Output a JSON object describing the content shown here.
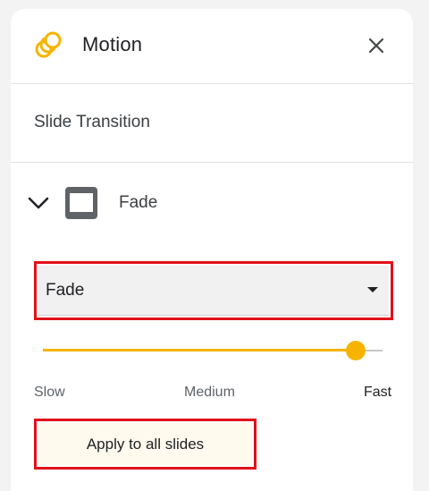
{
  "header": {
    "title": "Motion",
    "icon": "motion-icon",
    "close_icon": "close-icon"
  },
  "section": {
    "title": "Slide Transition"
  },
  "transition": {
    "expand_icon": "chevron-down-icon",
    "thumbnail_icon": "slide-thumbnail-icon",
    "name": "Fade"
  },
  "type_select": {
    "value": "Fade"
  },
  "speed": {
    "labels": {
      "slow": "Slow",
      "medium": "Medium",
      "fast": "Fast"
    },
    "value_fraction": 0.92
  },
  "apply_button": {
    "label": "Apply to all slides"
  },
  "colors": {
    "accent": "#f6b400",
    "highlight": "#e3101a",
    "apply_bg": "#fffaee"
  }
}
